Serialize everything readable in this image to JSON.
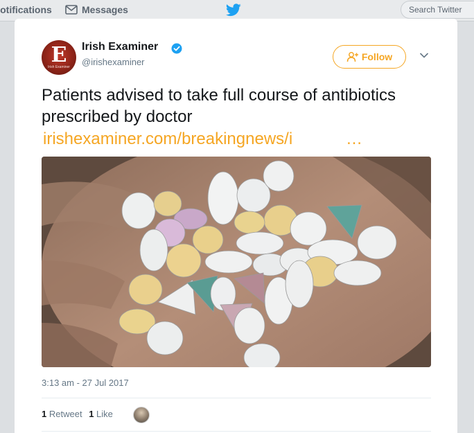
{
  "nav": {
    "notifications_label": "Notifications",
    "messages_label": "Messages",
    "search_placeholder": "Search Twitter"
  },
  "tweet": {
    "display_name": "Irish Examiner",
    "handle": "@irishexaminer",
    "avatar_letter": "E",
    "avatar_subtext": "Irish Examiner",
    "follow_label": "Follow",
    "text": "Patients advised to take full course of antibiotics prescribed by doctor",
    "link": "irishexaminer.com/breakingnews/i",
    "link_ellipsis": "…",
    "media_alt": "",
    "timestamp": "3:13 am - 27 Jul 2017",
    "retweet_count": "1",
    "retweet_label": "Retweet",
    "like_count": "1",
    "like_label": "Like"
  },
  "colors": {
    "accent": "#f5a623",
    "verified": "#1da1f2",
    "muted": "#657786"
  }
}
